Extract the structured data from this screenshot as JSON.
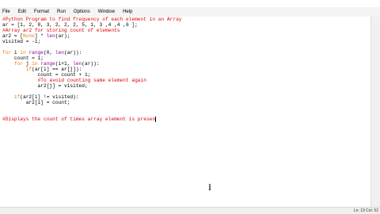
{
  "menu": {
    "items": [
      "File",
      "Edit",
      "Format",
      "Run",
      "Options",
      "Window",
      "Help"
    ]
  },
  "code": {
    "lines": [
      {
        "segments": [
          {
            "t": "cm",
            "v": "#Python Program to find frequency of each element in an Array"
          }
        ]
      },
      {
        "segments": [
          {
            "t": "",
            "v": "ar = [1, 2, 8, 3, 2, 2, 2, 5, 1, 3 ,4 ,4 ,6 ];"
          }
        ]
      },
      {
        "segments": [
          {
            "t": "cm",
            "v": "#Array ar2 for storing count of elements"
          }
        ]
      },
      {
        "segments": [
          {
            "t": "",
            "v": "ar2 = ["
          },
          {
            "t": "kw",
            "v": "None"
          },
          {
            "t": "",
            "v": "] * "
          },
          {
            "t": "bi",
            "v": "len"
          },
          {
            "t": "",
            "v": "(ar);"
          }
        ]
      },
      {
        "segments": [
          {
            "t": "",
            "v": "visited = -1;"
          }
        ]
      },
      {
        "segments": [
          {
            "t": "",
            "v": ""
          }
        ]
      },
      {
        "segments": [
          {
            "t": "kw",
            "v": "for"
          },
          {
            "t": "",
            "v": " i "
          },
          {
            "t": "kw",
            "v": "in"
          },
          {
            "t": "",
            "v": " "
          },
          {
            "t": "bi",
            "v": "range"
          },
          {
            "t": "",
            "v": "(0, "
          },
          {
            "t": "bi",
            "v": "len"
          },
          {
            "t": "",
            "v": "(ar)):"
          }
        ]
      },
      {
        "segments": [
          {
            "t": "",
            "v": "    count = 1;"
          }
        ]
      },
      {
        "segments": [
          {
            "t": "",
            "v": "    "
          },
          {
            "t": "kw",
            "v": "for"
          },
          {
            "t": "",
            "v": " j "
          },
          {
            "t": "kw",
            "v": "in"
          },
          {
            "t": "",
            "v": " "
          },
          {
            "t": "bi",
            "v": "range"
          },
          {
            "t": "",
            "v": "(i+1, "
          },
          {
            "t": "bi",
            "v": "len"
          },
          {
            "t": "",
            "v": "(ar)):"
          }
        ]
      },
      {
        "segments": [
          {
            "t": "",
            "v": "        "
          },
          {
            "t": "kw",
            "v": "if"
          },
          {
            "t": "",
            "v": "(ar[i] == ar[j]):"
          }
        ]
      },
      {
        "segments": [
          {
            "t": "",
            "v": "            count = count + 1;"
          }
        ]
      },
      {
        "segments": [
          {
            "t": "",
            "v": "            "
          },
          {
            "t": "cm",
            "v": "#To avoid counting same element again"
          }
        ]
      },
      {
        "segments": [
          {
            "t": "",
            "v": "            ar2[j] = visited;"
          }
        ]
      },
      {
        "segments": [
          {
            "t": "",
            "v": ""
          }
        ]
      },
      {
        "segments": [
          {
            "t": "",
            "v": "    "
          },
          {
            "t": "kw",
            "v": "if"
          },
          {
            "t": "",
            "v": "(ar2[i] != visited):"
          }
        ]
      },
      {
        "segments": [
          {
            "t": "",
            "v": "        ar2[i] = count;"
          }
        ]
      },
      {
        "segments": [
          {
            "t": "",
            "v": ""
          }
        ]
      },
      {
        "segments": [
          {
            "t": "",
            "v": ""
          }
        ]
      },
      {
        "segments": [
          {
            "t": "cm",
            "v": "#Displays the count of times array element is presen"
          }
        ]
      }
    ]
  },
  "cursor_line": 18,
  "status": {
    "position": "Ln: 19   Col: 52"
  },
  "colors": {
    "keyword": "#ff7700",
    "comment": "#dd0000",
    "builtin": "#900090",
    "background": "#ffffff"
  },
  "icons": {
    "mouse_cursor": "text-ibeam-icon"
  }
}
